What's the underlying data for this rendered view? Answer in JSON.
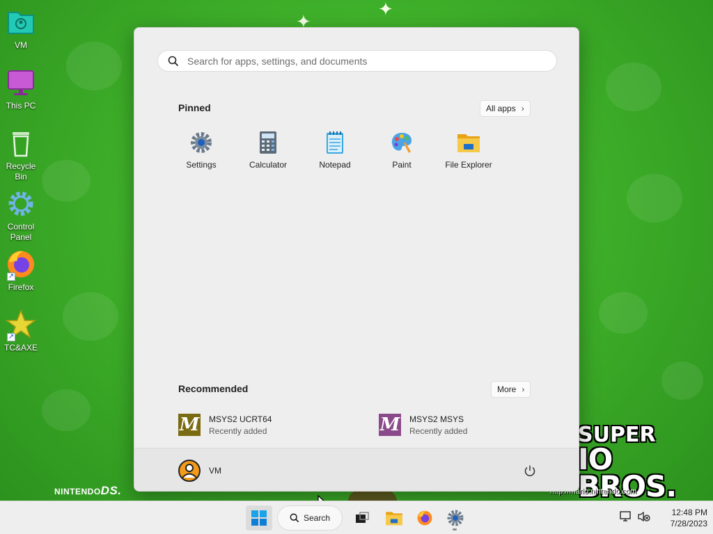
{
  "desktop": {
    "icons": [
      {
        "label": "VM"
      },
      {
        "label": "This PC"
      },
      {
        "label": "Recycle Bin"
      },
      {
        "label": "Control Panel"
      },
      {
        "label": "Firefox"
      },
      {
        "label": "TC&AXE"
      }
    ],
    "wallpaper": {
      "logo_line1": "SUPER",
      "logo_line2": "IO BROS.",
      "url": "http://mario.nintendo.com",
      "ds_brand": "NINTENDO",
      "ds_suffix": "DS."
    }
  },
  "start_menu": {
    "search_placeholder": "Search for apps, settings, and documents",
    "pinned_title": "Pinned",
    "all_apps_label": "All apps",
    "pinned": [
      {
        "name": "Settings",
        "icon": "settings-icon"
      },
      {
        "name": "Calculator",
        "icon": "calculator-icon"
      },
      {
        "name": "Notepad",
        "icon": "notepad-icon"
      },
      {
        "name": "Paint",
        "icon": "paint-icon"
      },
      {
        "name": "File Explorer",
        "icon": "file-explorer-icon"
      }
    ],
    "recommended_title": "Recommended",
    "more_label": "More",
    "recommended": [
      {
        "title": "MSYS2 UCRT64",
        "subtitle": "Recently added",
        "letter": "M",
        "color": "#7a6a12"
      },
      {
        "title": "MSYS2 MSYS",
        "subtitle": "Recently added",
        "letter": "M",
        "color": "#8a4a8a"
      }
    ],
    "user_name": "VM"
  },
  "taskbar": {
    "search_label": "Search",
    "time": "12:48 PM",
    "date": "7/28/2023"
  },
  "colors": {
    "accent": "#0067c0",
    "desktop_green": "#3fb02a",
    "menu_bg": "#eeeeee"
  }
}
